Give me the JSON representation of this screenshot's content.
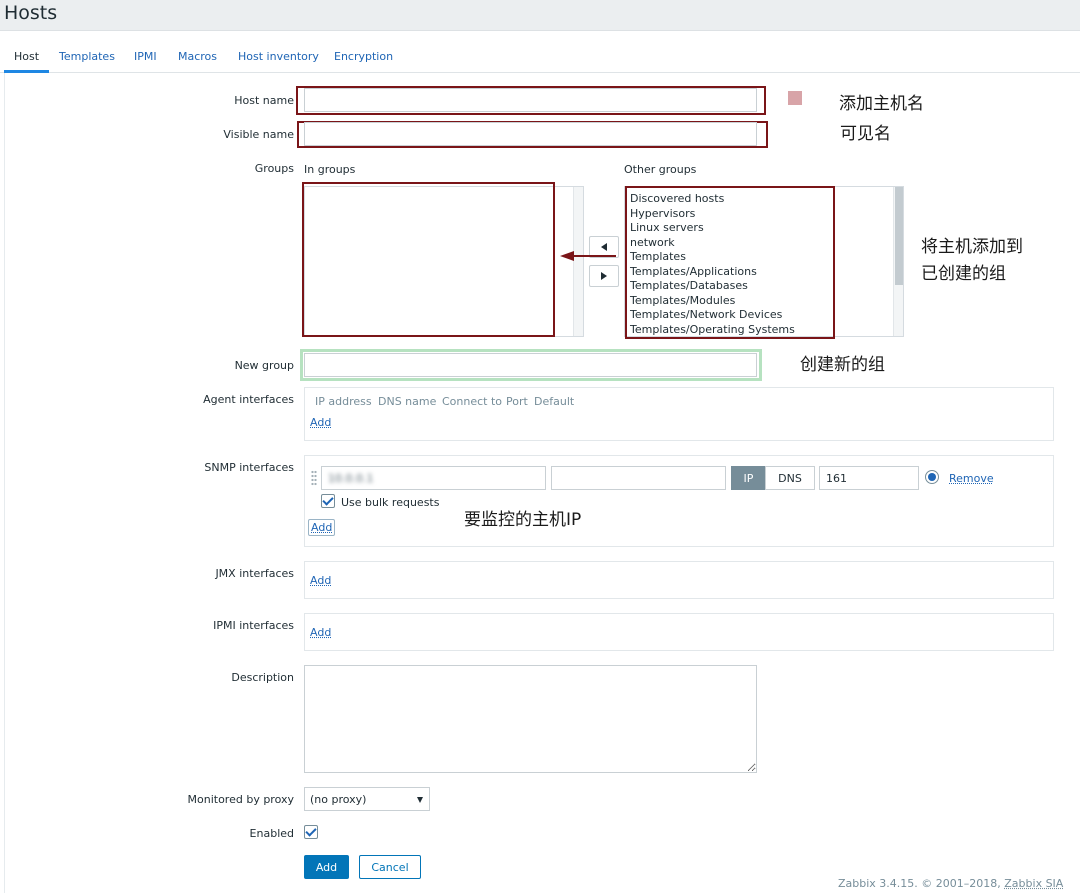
{
  "page": {
    "title": "Hosts"
  },
  "tabs": [
    {
      "label": "Host"
    },
    {
      "label": "Templates"
    },
    {
      "label": "IPMI"
    },
    {
      "label": "Macros"
    },
    {
      "label": "Host inventory"
    },
    {
      "label": "Encryption"
    }
  ],
  "form": {
    "host_name": {
      "label": "Host name",
      "value": ""
    },
    "visible_name": {
      "label": "Visible name",
      "value": ""
    },
    "groups": {
      "label": "Groups",
      "in_groups_label": "In groups",
      "other_groups_label": "Other groups",
      "in_groups": [],
      "other_groups": [
        "Discovered hosts",
        "Hypervisors",
        "Linux servers",
        "network",
        "Templates",
        "Templates/Applications",
        "Templates/Databases",
        "Templates/Modules",
        "Templates/Network Devices",
        "Templates/Operating Systems"
      ]
    },
    "new_group": {
      "label": "New group",
      "value": ""
    },
    "agent_interfaces": {
      "label": "Agent interfaces",
      "columns": [
        "IP address",
        "DNS name",
        "Connect to",
        "Port",
        "Default"
      ],
      "add_label": "Add"
    },
    "snmp_interfaces": {
      "label": "SNMP interfaces",
      "ip_value": "10.0.0.1",
      "dns_value": "",
      "connect_ip": "IP",
      "connect_dns": "DNS",
      "port": "161",
      "remove_label": "Remove",
      "bulk_label": "Use bulk requests",
      "add_label": "Add"
    },
    "jmx_interfaces": {
      "label": "JMX interfaces",
      "add_label": "Add"
    },
    "ipmi_interfaces": {
      "label": "IPMI interfaces",
      "add_label": "Add"
    },
    "description": {
      "label": "Description",
      "value": ""
    },
    "proxy": {
      "label": "Monitored by proxy",
      "value": "(no proxy)"
    },
    "enabled": {
      "label": "Enabled"
    },
    "add_button": "Add",
    "cancel_button": "Cancel"
  },
  "annotations": {
    "host_name": "添加主机名",
    "visible_name": "可见名",
    "groups_line1": "将主机添加到",
    "groups_line2": "已创建的组",
    "new_group": "创建新的组",
    "snmp": "要监控的主机IP"
  },
  "footer": {
    "text": "Zabbix 3.4.15. © 2001–2018,",
    "link": "Zabbix SIA"
  },
  "colors": {
    "annotation_box": "#7a1518",
    "new_group_highlight": "#b6e2c0",
    "primary": "#0275b8",
    "marker": "#d8a4a8"
  }
}
